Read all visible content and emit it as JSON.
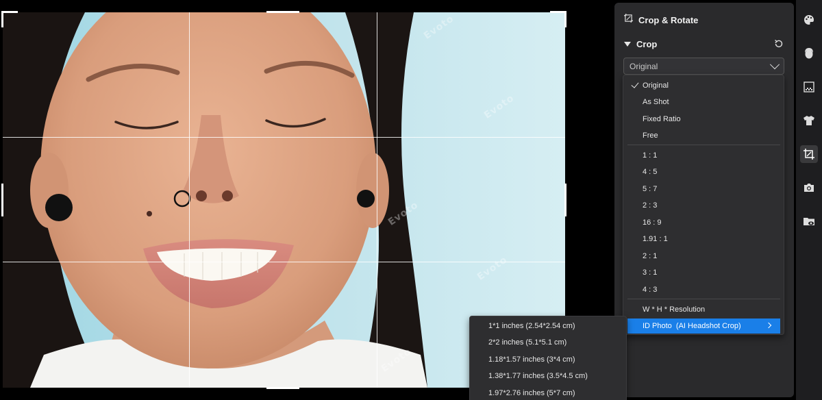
{
  "panel": {
    "title": "Crop & Rotate",
    "crop_label": "Crop",
    "select_value": "Original"
  },
  "ratio_menu": {
    "group1": [
      "Original",
      "As Shot",
      "Fixed Ratio",
      "Free"
    ],
    "group2": [
      "1 : 1",
      "4 : 5",
      "5 : 7",
      "2 : 3",
      "16 : 9",
      "1.91 : 1",
      "2 : 1",
      "3 : 1",
      "4 : 3"
    ],
    "group3": [
      "W * H * Resolution",
      "ID Photo  (AI Headshot Crop)"
    ],
    "checked": "Original",
    "highlighted": "ID Photo  (AI Headshot Crop)"
  },
  "id_photo_submenu": [
    "1*1 inches (2.54*2.54 cm)",
    "2*2 inches (5.1*5.1 cm)",
    "1.18*1.57 inches (3*4 cm)",
    "1.38*1.77 inches (3.5*4.5 cm)",
    "1.97*2.76 inches (5*7 cm)"
  ],
  "watermark_text": "Evoto",
  "toolbar_icons": [
    "palette-icon",
    "face-icon",
    "background-icon",
    "clothing-icon",
    "crop-icon",
    "camera-icon",
    "folder-eye-icon"
  ],
  "colors": {
    "accent": "#1a7fe8",
    "panel_bg": "#2a2a2c",
    "menu_bg": "#2e2e30"
  }
}
